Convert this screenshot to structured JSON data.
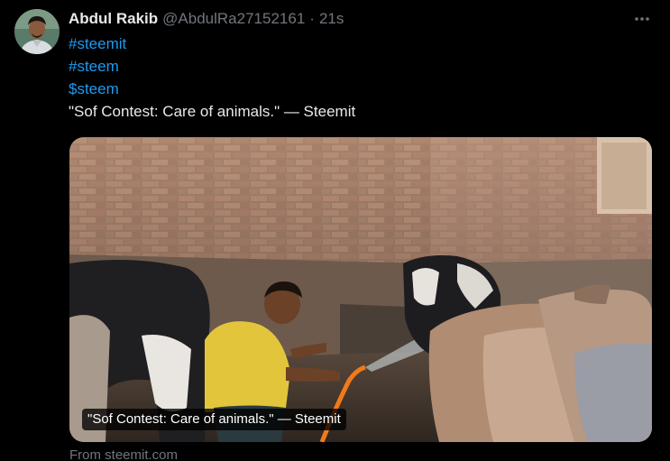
{
  "author": {
    "display_name": "Abdul Rakib",
    "handle": "@AbdulRa27152161",
    "separator": "·",
    "time": "21s",
    "avatar_icon": "user-avatar"
  },
  "tweet": {
    "hashtags": [
      "#steemit",
      "#steem"
    ],
    "cashtag": "$steem",
    "text": "\"Sof Contest: Care of animals.\" — Steemit"
  },
  "link_card": {
    "image_label": "\"Sof Contest: Care of animals.\" — Steemit",
    "source": "From steemit.com"
  },
  "menu_icon": "more-icon",
  "colors": {
    "background": "#000000",
    "text": "#e7e9ea",
    "secondary": "#71767b",
    "link": "#1d9bf0"
  }
}
